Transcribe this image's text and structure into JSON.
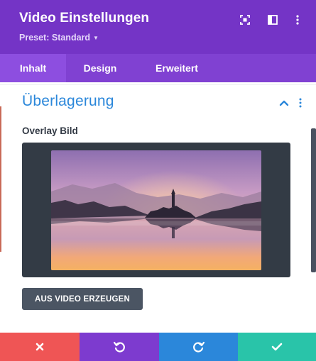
{
  "header": {
    "title": "Video Einstellungen",
    "preset_label": "Preset: Standard",
    "icons": [
      "fullscreen-icon",
      "layout-icon",
      "more-vertical-icon"
    ]
  },
  "tabs": [
    {
      "label": "Inhalt",
      "active": true
    },
    {
      "label": "Design",
      "active": false
    },
    {
      "label": "Erweitert",
      "active": false
    }
  ],
  "section": {
    "title": "Überlagerung",
    "field_label": "Overlay Bild",
    "generate_button_label": "AUS VIDEO ERZEUGEN"
  },
  "footer": {
    "buttons": [
      "cancel-icon",
      "undo-icon",
      "redo-icon",
      "save-icon"
    ]
  },
  "colors": {
    "header": "#7434c6",
    "tabs": "#8041d2",
    "active_tab": "#8d4ee0",
    "section_title": "#2b87da",
    "cancel": "#ef5555",
    "undo": "#7d3bcf",
    "redo": "#2b87da",
    "save": "#29c4a9"
  }
}
